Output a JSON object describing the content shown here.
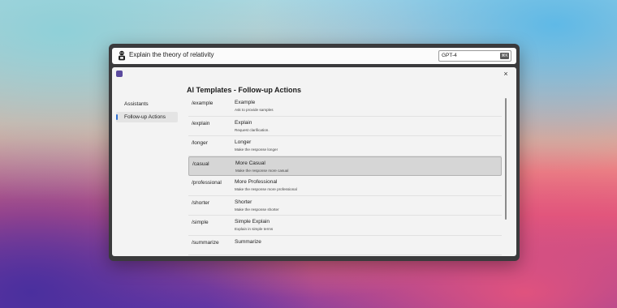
{
  "top_bar": {
    "query": "Explain the theory of relativity",
    "model": "GPT-4",
    "model_key": "⌘K"
  },
  "panel": {
    "close_icon": "×",
    "heading": "AI Templates - Follow-up Actions"
  },
  "sidebar": {
    "items": [
      {
        "label": "Assistants"
      },
      {
        "label": "Follow-up Actions"
      }
    ]
  },
  "templates": [
    {
      "cmd": "/example",
      "title": "Example",
      "desc": "Ask to provide samples"
    },
    {
      "cmd": "/explain",
      "title": "Explain",
      "desc": "Request clarification."
    },
    {
      "cmd": "/longer",
      "title": "Longer",
      "desc": "Make the response longer"
    },
    {
      "cmd": "/casual",
      "title": "More Casual",
      "desc": "Make the response more casual"
    },
    {
      "cmd": "/professional",
      "title": "More Professional",
      "desc": "Make the response more professional"
    },
    {
      "cmd": "/shorter",
      "title": "Shorter",
      "desc": "Make the response shorter"
    },
    {
      "cmd": "/simple",
      "title": "Simple Explain",
      "desc": "Explain in simple terms"
    },
    {
      "cmd": "/summarize",
      "title": "Summarize",
      "desc": ""
    }
  ],
  "selected_template": "/casual",
  "colors": {
    "accent": "#2f6fd0",
    "selected_row": "#d6d6d6",
    "window_frame": "#3a3a3c"
  },
  "icons": {
    "robot": "robot-icon",
    "app": "app-icon",
    "close": "close-icon"
  }
}
